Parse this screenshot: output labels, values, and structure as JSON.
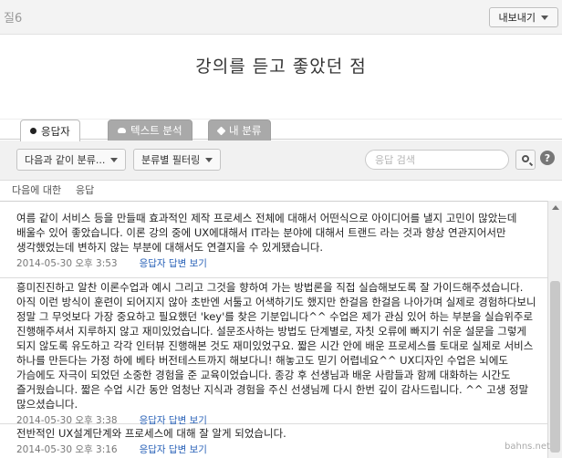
{
  "topbar": {
    "question_label": "질6",
    "export_label": "내보내기"
  },
  "page_title": "강의를 듣고 좋았던 점",
  "tabs": [
    {
      "label": "응답자",
      "active": true
    },
    {
      "label": "텍스트 분석",
      "active": false
    },
    {
      "label": "내 분류",
      "active": false
    }
  ],
  "toolbar": {
    "dropdown1": "다음과 같이 분류...",
    "dropdown2": "분류별 필터링",
    "search_placeholder": "응답 검색",
    "help_label": "?"
  },
  "columns": {
    "col1": "다음에 대한",
    "col2": "응답"
  },
  "responses": [
    {
      "text": "여름 같이 서비스 등을 만들때 효과적인 제작 프로세스 전체에 대해서 어떤식으로 아이디어를 낼지 고민이 많았는데 배울수 있어 좋았습니다. 이론 강의 중에 UX에대해서 IT라는 분야에 대해서 트랜드 라는 것과 향상 연관지어서만 생각했었는데 변하지 않는 부분에 대해서도 연결지을 수 있게됐습니다.",
      "timestamp": "2014-05-30 오후 3:53",
      "link": "응답자 답변 보기"
    },
    {
      "text": "흥미진진하고 알찬 이론수업과 예시 그리고 그것을 향하여 가는 방법론을 직접 실습해보도록 잘 가이드해주셨습니다. 아직 이런 방식이 훈련이 되어지지 않아 초반엔 서툴고 어색하기도 했지만 한걸음 한걸음 나아가며 실제로 경험하다보니 정말 그 무엇보다 가장 중요하고 필요했던 'key'를 찾은 기분입니다^^ 수업은 제가 관심 있어 하는 부분을 실습위주로 진행해주셔서 지루하지 않고 재미있었습니다. 설문조사하는 방법도 단계별로, 자칫 오류에 빠지기 쉬운 설문을 그렇게 되지 않도록 유도하고 각각 인터뷰 진행해본 것도 재미있었구요. 짧은 시간 안에 배운 프로세스를 토대로 실제로 서비스 하나를 만든다는 가정 하에 베타 버전테스트까지 해보다니! 해놓고도 믿기 어렵네요^^ UX디자인 수업은 뇌에도 가슴에도 자극이 되었던 소중한 경험을 준 교육이었습니다. 종강 후 선생님과 배운 사람들과 함께 대화하는 시간도 즐거웠습니다. 짧은 수업 시간 동안 엄청난 지식과 경험을 주신 선생님께 다시 한번 깊이 감사드립니다. ^^ 고생 정말 많으셨습니다.",
      "timestamp": "2014-05-30 오후 3:38",
      "link": "응답자 답변 보기"
    },
    {
      "text": "전반적인 UX설계단계와 프로세스에 대해 잘 알게 되었습니다.",
      "timestamp": "2014-05-30 오후 3:16",
      "link": "응답자 답변 보기"
    }
  ],
  "watermark": "bahns.net"
}
